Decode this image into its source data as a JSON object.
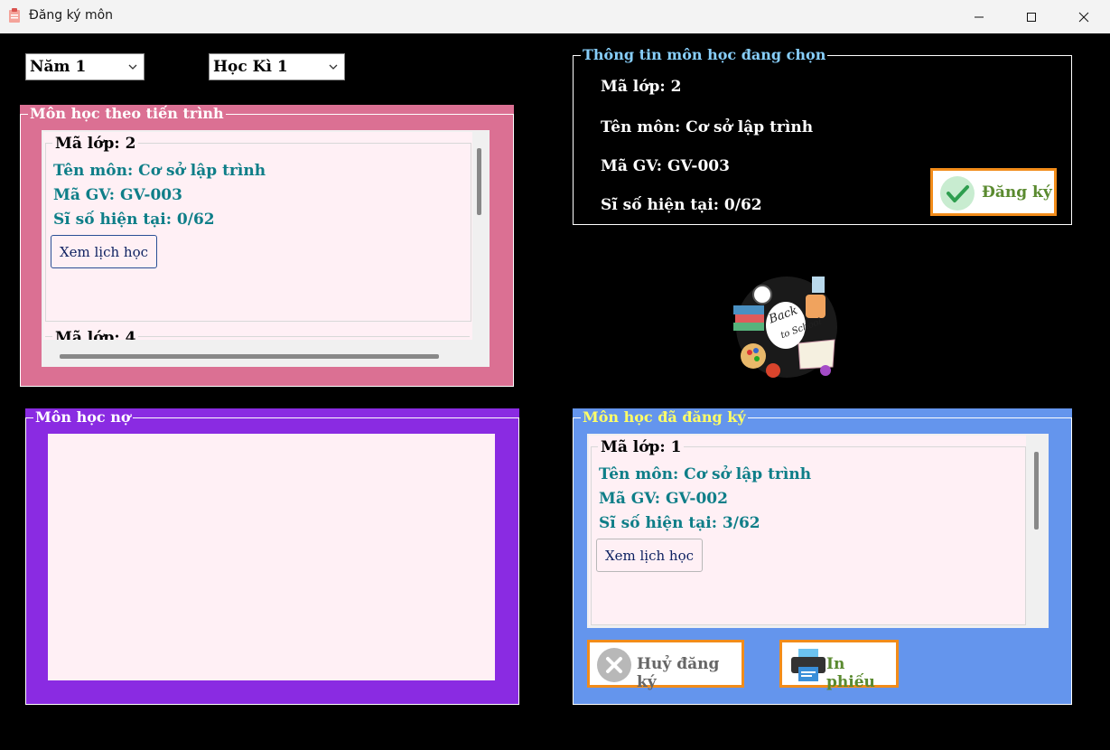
{
  "window": {
    "title": "Đăng ký môn"
  },
  "filters": {
    "year": "Năm 1",
    "semester": "Học Kì 1"
  },
  "progress_group": {
    "title": "Môn học theo tiến trình",
    "cards": [
      {
        "class_label": "Mã lớp: 2",
        "subject": "Tên môn: Cơ sở lập trình",
        "teacher": "Mã GV: GV-003",
        "enrollment": "Sĩ số hiện tại: 0/62",
        "schedule_button": "Xem lịch học"
      },
      {
        "class_label": "Mã lớp: 4"
      }
    ]
  },
  "debt_group": {
    "title": "Môn học nợ"
  },
  "selected_info": {
    "title": "Thông tin môn học đang chọn",
    "class_label": "Mã lớp: 2",
    "subject": "Tên môn: Cơ sở lập trình",
    "teacher": "Mã GV: GV-003",
    "enrollment": "Sĩ số hiện tại: 0/62",
    "register_button": "Đăng ký"
  },
  "illustration": {
    "text": "Back to School"
  },
  "registered_group": {
    "title": "Môn học đã đăng ký",
    "cards": [
      {
        "class_label": "Mã lớp: 1",
        "subject": "Tên môn: Cơ sở lập trình",
        "teacher": "Mã GV: GV-002",
        "enrollment": "Sĩ số hiện tại: 3/62",
        "schedule_button": "Xem lịch học"
      }
    ],
    "cancel_button": "Huỷ đăng ký",
    "print_button": "In phiếu"
  },
  "colors": {
    "progress_bg": "#db7093",
    "debt_bg": "#8a2be2",
    "registered_bg": "#6495ed",
    "card_bg": "#fff0f5",
    "teal_text": "#0e7e88",
    "info_label": "#87cefa",
    "registered_label": "#ffff66",
    "button_border": "#f28c1a"
  }
}
